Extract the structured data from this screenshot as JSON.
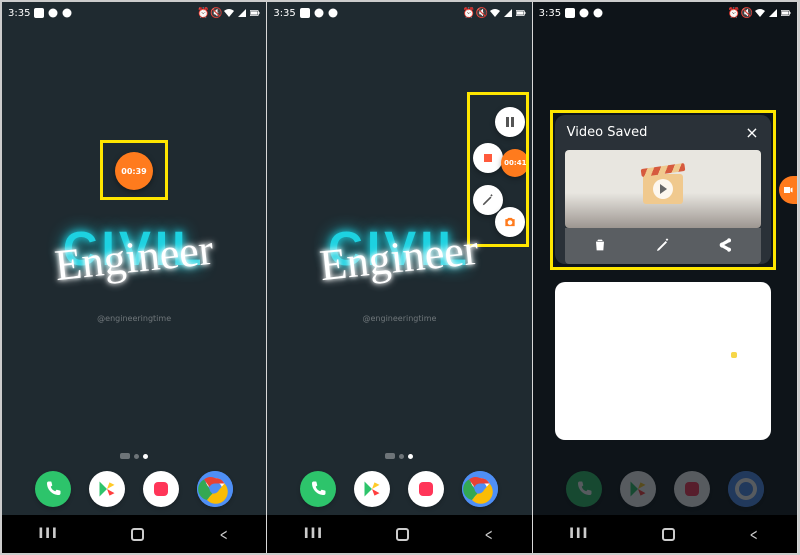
{
  "status_bar": {
    "time": "3:35",
    "icons_left": [
      "gallery",
      "chat",
      "messenger"
    ],
    "icons_right": [
      "alarm",
      "mute",
      "wifi",
      "signal",
      "battery"
    ]
  },
  "wallpaper": {
    "line1": "CIVIL",
    "line2": "Engineer",
    "handle": "@engineeringtime"
  },
  "panel1": {
    "record_timer": "00:39"
  },
  "panel2": {
    "menu_timer": "00:41",
    "buttons": {
      "pause_label": "pause",
      "stop_label": "stop",
      "draw_label": "draw",
      "camera_label": "camera"
    }
  },
  "panel3": {
    "card_title": "Video Saved",
    "close_label": "×",
    "actions": {
      "delete": "delete",
      "edit": "edit",
      "share": "share"
    },
    "side_tab": "record"
  },
  "dock": {
    "items": [
      "phone",
      "play-store",
      "camera",
      "chrome"
    ]
  },
  "navbar": {
    "recent": "III",
    "home": "home",
    "back": "<"
  },
  "colors": {
    "accent_orange": "#ff7b1d",
    "highlight": "#ffe600",
    "neon": "#1dd2e1"
  }
}
